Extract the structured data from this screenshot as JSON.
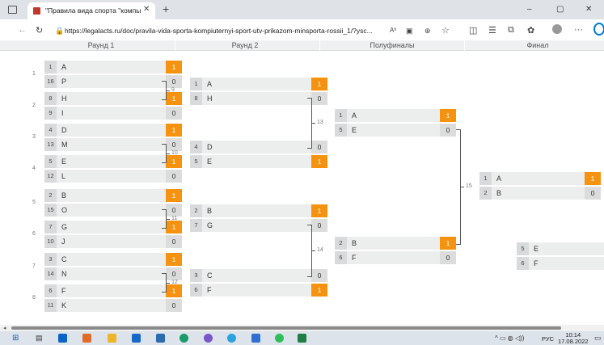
{
  "browser": {
    "tab_title": "\"Правила вида спорта \"компьк",
    "tab_close": "✕",
    "new_tab": "+",
    "url": "https://legalacts.ru/doc/pravila-vida-sporta-kompiuternyi-sport-utv-prikazom-minsporta-rossii_1/?ysc...",
    "reader_label": "Aʰ",
    "win_min": "–",
    "win_max": "▢",
    "win_close": "✕",
    "more_label": "···"
  },
  "rounds": [
    "Раунд 1",
    "Раунд 2",
    "Полуфиналы",
    "Финал"
  ],
  "round1": [
    {
      "game": "1",
      "top": {
        "seed": "1",
        "team": "A",
        "score": "1",
        "win": true
      },
      "bot": {
        "seed": "16",
        "team": "P",
        "score": "0",
        "win": false
      }
    },
    {
      "game": "2",
      "top": {
        "seed": "8",
        "team": "H",
        "score": "1",
        "win": true
      },
      "bot": {
        "seed": "9",
        "team": "I",
        "score": "0",
        "win": false
      }
    },
    {
      "game": "3",
      "top": {
        "seed": "4",
        "team": "D",
        "score": "1",
        "win": true
      },
      "bot": {
        "seed": "13",
        "team": "M",
        "score": "0",
        "win": false
      }
    },
    {
      "game": "4",
      "top": {
        "seed": "5",
        "team": "E",
        "score": "1",
        "win": true
      },
      "bot": {
        "seed": "12",
        "team": "L",
        "score": "0",
        "win": false
      }
    },
    {
      "game": "5",
      "top": {
        "seed": "2",
        "team": "B",
        "score": "1",
        "win": true
      },
      "bot": {
        "seed": "15",
        "team": "O",
        "score": "0",
        "win": false
      }
    },
    {
      "game": "6",
      "top": {
        "seed": "7",
        "team": "G",
        "score": "1",
        "win": true
      },
      "bot": {
        "seed": "10",
        "team": "J",
        "score": "0",
        "win": false
      }
    },
    {
      "game": "7",
      "top": {
        "seed": "3",
        "team": "C",
        "score": "1",
        "win": true
      },
      "bot": {
        "seed": "14",
        "team": "N",
        "score": "0",
        "win": false
      }
    },
    {
      "game": "8",
      "top": {
        "seed": "6",
        "team": "F",
        "score": "1",
        "win": true
      },
      "bot": {
        "seed": "11",
        "team": "K",
        "score": "0",
        "win": false
      }
    }
  ],
  "round2": [
    {
      "game": "9",
      "top": {
        "seed": "1",
        "team": "A",
        "score": "1",
        "win": true
      },
      "bot": {
        "seed": "8",
        "team": "H",
        "score": "0",
        "win": false
      }
    },
    {
      "game": "10",
      "top": {
        "seed": "4",
        "team": "D",
        "score": "0",
        "win": false
      },
      "bot": {
        "seed": "5",
        "team": "E",
        "score": "1",
        "win": true
      }
    },
    {
      "game": "11",
      "top": {
        "seed": "2",
        "team": "B",
        "score": "1",
        "win": true
      },
      "bot": {
        "seed": "7",
        "team": "G",
        "score": "0",
        "win": false
      }
    },
    {
      "game": "12",
      "top": {
        "seed": "3",
        "team": "C",
        "score": "0",
        "win": false
      },
      "bot": {
        "seed": "6",
        "team": "F",
        "score": "1",
        "win": true
      }
    }
  ],
  "semis": [
    {
      "game": "13",
      "top": {
        "seed": "1",
        "team": "A",
        "score": "1",
        "win": true
      },
      "bot": {
        "seed": "5",
        "team": "E",
        "score": "0",
        "win": false
      }
    },
    {
      "game": "14",
      "top": {
        "seed": "2",
        "team": "B",
        "score": "1",
        "win": true
      },
      "bot": {
        "seed": "6",
        "team": "F",
        "score": "0",
        "win": false
      }
    }
  ],
  "final": {
    "game": "15",
    "top": {
      "seed": "1",
      "team": "A",
      "score": "1",
      "win": true
    },
    "bot": {
      "seed": "2",
      "team": "B",
      "score": "0",
      "win": false
    }
  },
  "third_place": {
    "top": {
      "seed": "5",
      "team": "E"
    },
    "bot": {
      "seed": "6",
      "team": "F"
    }
  },
  "taskbar": {
    "lang": "РУС",
    "time": "10:14",
    "date": "17.08.2022"
  },
  "colors": {
    "win": "#f5920f",
    "row": "#eceded",
    "accent": "#0078d4"
  }
}
